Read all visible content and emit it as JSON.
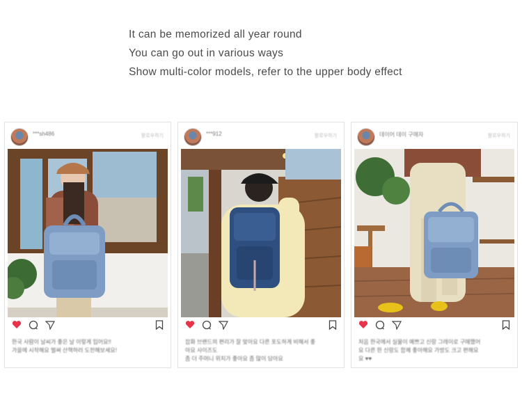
{
  "intro": {
    "lines": [
      "It can be memorized all year round",
      "You can go out in various ways",
      "Show multi-color models, refer to the upper body effect"
    ]
  },
  "posts": [
    {
      "username": "***sh486",
      "follow_label": "팔로우하기",
      "caption_lines": [
        "한국 사람이 날씨가 좋은 날 이렇게 입어요!!",
        "가을에 시작해요 벌써 산책하러 도전해보세요!"
      ]
    },
    {
      "username": "***912",
      "follow_label": "팔로우하기",
      "caption_lines": [
        "잡화 브랜드의 편리가 잘 맞아요 다른 포도하게 비해서 좋",
        "아요 사이즈도",
        "좀 더 주머니 위치가 좋아요 좀 많이 담아요"
      ]
    },
    {
      "username": "데이어 데이 구매자",
      "follow_label": "팔로우하기",
      "caption_lines": [
        "처음 한국에서 실물이 예쁘고 신랑 그레이로 구매했어",
        "요 다른 한 신랑도 함께 좋아해요 가방도 크고 편해요",
        "요 ♥♥"
      ]
    }
  ],
  "colors": {
    "heart": "#e8344a",
    "icon": "#444444",
    "denim_light": "#7f9dc4",
    "denim_dark": "#2f4f80"
  },
  "icons": [
    "heart-icon",
    "comment-icon",
    "share-icon",
    "bookmark-icon"
  ]
}
